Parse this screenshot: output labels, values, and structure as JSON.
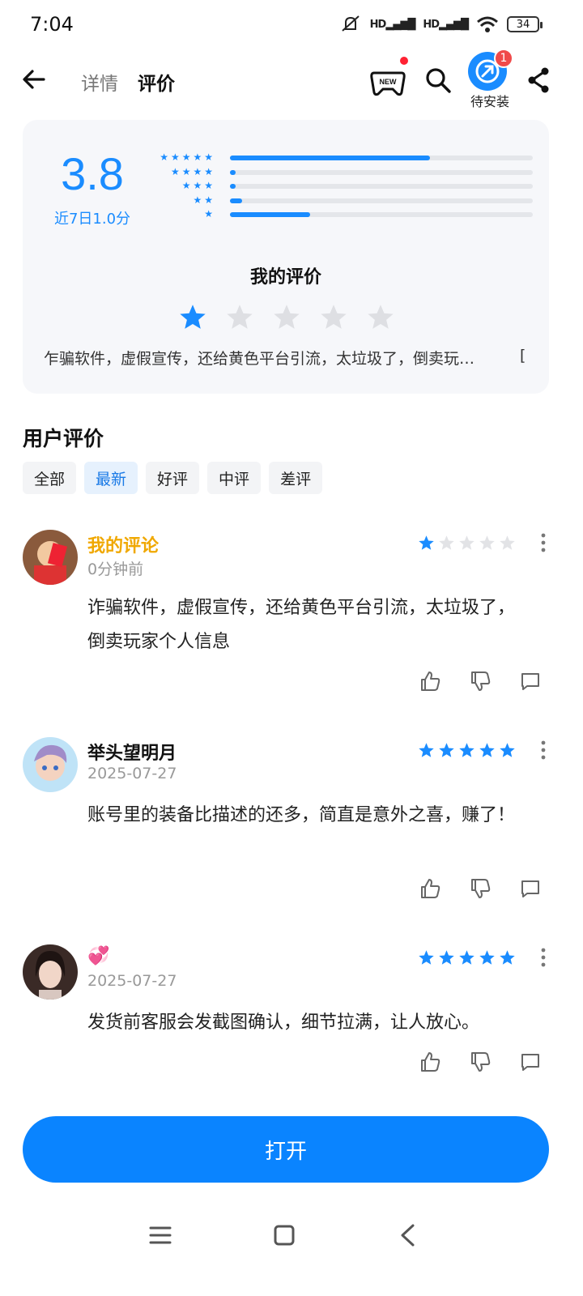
{
  "status_bar": {
    "time": "7:04",
    "battery": "34",
    "signal_label": "HD"
  },
  "nav": {
    "tabs": [
      {
        "label": "详情",
        "active": false
      },
      {
        "label": "评价",
        "active": true
      }
    ],
    "gamepad_badge_text": "NEW",
    "pending_install_label": "待安装",
    "pending_install_count": "1"
  },
  "rating": {
    "score": "3.8",
    "recent": "近7日1.0分",
    "distribution": [
      {
        "stars": 5,
        "fraction": 0.66
      },
      {
        "stars": 4,
        "fraction": 0.02
      },
      {
        "stars": 3,
        "fraction": 0.02
      },
      {
        "stars": 2,
        "fraction": 0.04
      },
      {
        "stars": 1,
        "fraction": 0.265
      }
    ],
    "my_review_title": "我的评价",
    "my_rating": 1,
    "my_review_preview": "乍骗软件，虚假宣传，还给黄色平台引流，太垃圾了，倒卖玩…",
    "my_review_edge": "["
  },
  "reviews_section": {
    "title": "用户评价",
    "filters": [
      {
        "label": "全部",
        "active": false
      },
      {
        "label": "最新",
        "active": true
      },
      {
        "label": "好评",
        "active": false
      },
      {
        "label": "中评",
        "active": false
      },
      {
        "label": "差评",
        "active": false
      }
    ]
  },
  "reviews": [
    {
      "name": "我的评论",
      "date": "0分钟前",
      "stars": 1,
      "text": "诈骗软件，虚假宣传，还给黄色平台引流，太垃圾了，倒卖玩家个人信息",
      "mine": true
    },
    {
      "name": "举头望明月",
      "date": "2025-07-27",
      "stars": 5,
      "text": "账号里的装备比描述的还多，简直是意外之喜，赚了！",
      "mine": false
    },
    {
      "name": "💞",
      "date": "2025-07-27",
      "stars": 5,
      "text": "发货前客服会发截图确认，细节拉满，让人放心。",
      "mine": false
    }
  ],
  "open_button": "打开",
  "colors": {
    "accent": "#1a8cff",
    "button": "#0a84ff",
    "mine_name": "#f0a800"
  },
  "icons": [
    "arrow-left-icon",
    "gamepad-icon",
    "search-icon",
    "install-icon",
    "share-icon",
    "star-icon",
    "more-vertical-icon",
    "thumbs-up-icon",
    "thumbs-down-icon",
    "comment-icon",
    "menu-icon",
    "home-icon",
    "chevron-left-icon"
  ]
}
